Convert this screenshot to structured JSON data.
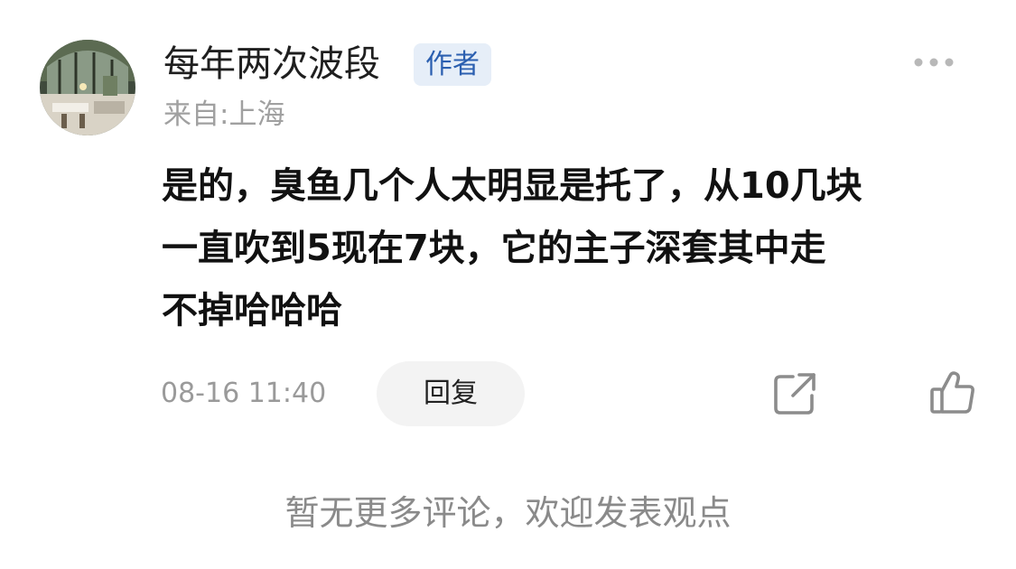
{
  "comment": {
    "username": "每年两次波段",
    "author_badge": "作者",
    "location": "来自:上海",
    "text_lines": [
      "是的，臭鱼几个人太明显是托了，从10几块",
      "一直吹到5现在7块，它的主子深套其中走",
      "不掉哈哈哈"
    ],
    "timestamp": "08-16 11:40",
    "reply_label": "回复",
    "icons": {
      "more": "more-dots-icon",
      "share": "share-icon",
      "like": "thumbs-up-icon"
    }
  },
  "footer": {
    "no_more_comments": "暂无更多评论，欢迎发表观点"
  },
  "colors": {
    "badge_bg": "#e6eef8",
    "badge_text": "#2b5fb0",
    "muted_text": "#9a9a9a",
    "reply_bg": "#f3f3f3"
  }
}
